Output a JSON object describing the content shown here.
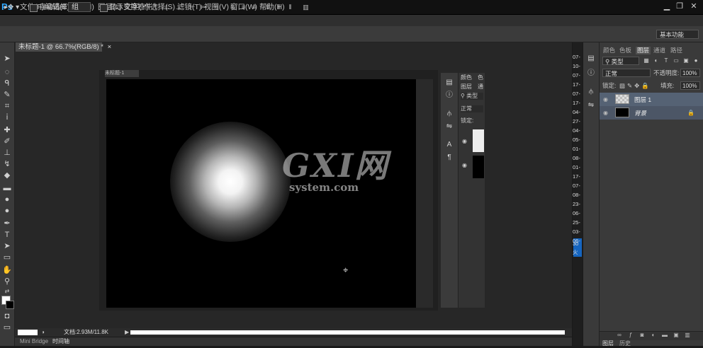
{
  "app": {
    "logo": "Ps"
  },
  "menubar": {
    "items": [
      "文件(F)",
      "编辑(E)",
      "图像(I)",
      "图层(L)",
      "文字(Y)",
      "选择(S)",
      "滤镜(T)",
      "视图(V)",
      "窗口(W)",
      "帮助(H)"
    ],
    "window_controls": [
      "▁",
      "❐",
      "✕"
    ]
  },
  "options": {
    "auto_select_label": "自动选择:",
    "auto_select_value": "组",
    "show_transform_label": "显示变换控件",
    "workspace": "基本功能"
  },
  "document": {
    "tab_title": "未标题-1 @ 66.7%(RGB/8) *",
    "tab_close": "×",
    "inner_title": "未标题-1",
    "status_text": "文档:2.93M/11.8K",
    "bottom_tabs": [
      "Mini Bridge",
      "时间轴"
    ]
  },
  "watermark": {
    "logo": "GXI网",
    "sub": "system.com"
  },
  "inner_panel": {
    "tabs": [
      "颜色",
      "色"
    ],
    "tabs2": [
      "图层",
      "通"
    ],
    "kind": "类型",
    "blend": "正常",
    "lock_label": "锁定:"
  },
  "narrow_strip": {
    "labels": [
      "07-",
      "10-",
      "07-",
      "17-",
      "07-",
      "17-",
      "04-",
      "27-",
      "04-",
      "05-",
      "01-",
      "08-",
      "01-",
      "17-",
      "07-",
      "08-",
      "23-",
      "06-",
      "25-",
      "03-",
      "06-",
      "30",
      "火"
    ]
  },
  "layers": {
    "tabs": [
      "颜色",
      "色板",
      "图层",
      "通道",
      "路径"
    ],
    "active_tab": "图层",
    "kind": "类型",
    "blend_mode": "正常",
    "opacity_label": "不透明度:",
    "opacity_value": "100%",
    "lock_label": "锁定:",
    "fill_label": "填充:",
    "fill_value": "100%",
    "rows": [
      {
        "name": "图层 1",
        "lock": ""
      },
      {
        "name": "背景",
        "lock": "🔒"
      }
    ],
    "bottom_tabs": [
      "图层",
      "历史"
    ]
  },
  "colors": {
    "accent": "#31a8ff",
    "selected_row": "#556274",
    "active_strip": "#1565c0"
  }
}
